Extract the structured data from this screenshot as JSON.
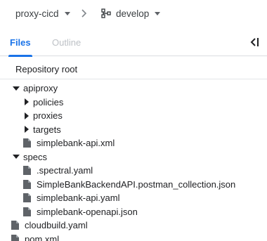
{
  "header": {
    "repo_name": "proxy-cicd",
    "branch_name": "develop"
  },
  "tabs": [
    {
      "label": "Files",
      "active": true
    },
    {
      "label": "Outline",
      "active": false
    }
  ],
  "repository_root_label": "Repository root",
  "tree": {
    "apiproxy": "apiproxy",
    "policies": "policies",
    "proxies": "proxies",
    "targets": "targets",
    "simplebank_api_xml": "simplebank-api.xml",
    "specs": "specs",
    "spectral_yaml": ".spectral.yaml",
    "postman_collection": "SimpleBankBackendAPI.postman_collection.json",
    "simplebank_api_yaml": "simplebank-api.yaml",
    "simplebank_openapi_json": "simplebank-openapi.json",
    "cloudbuild_yaml": "cloudbuild.yaml",
    "pom_xml": "pom.xml"
  },
  "colors": {
    "accent": "#1a73e8",
    "text": "#202124",
    "icon": "#5f6368",
    "inactive_tab": "#bdc1c6"
  }
}
